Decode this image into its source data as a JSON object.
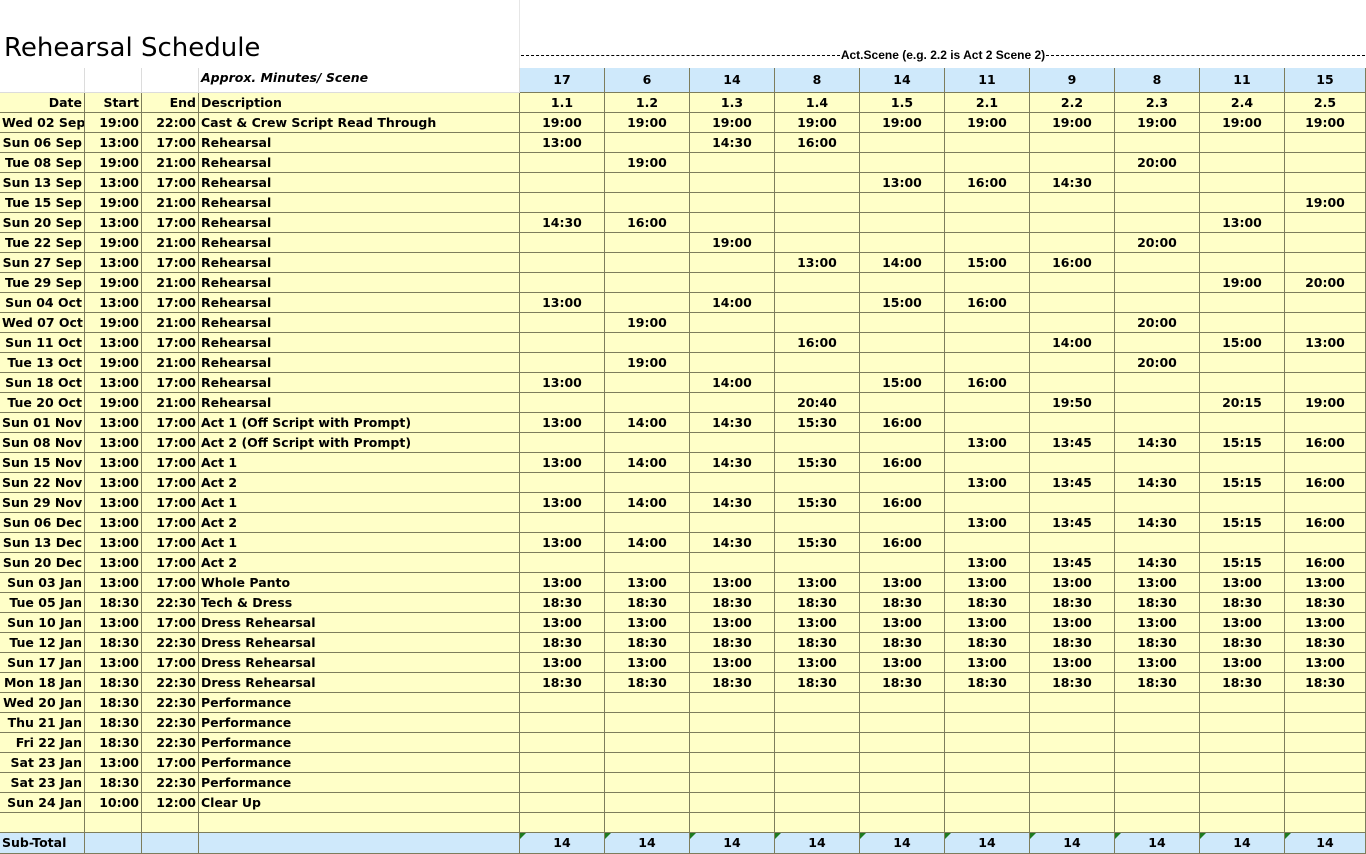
{
  "title": "Rehearsal Schedule",
  "act_scene_label": "Act.Scene (e.g. 2.2 is Act 2 Scene 2)",
  "minutes_label": "Approx. Minutes/ Scene",
  "minutes": [
    "17",
    "6",
    "14",
    "8",
    "14",
    "11",
    "9",
    "8",
    "11",
    "15"
  ],
  "headers": {
    "date": "Date",
    "start": "Start",
    "end": "End",
    "description": "Description"
  },
  "scenes": [
    "1.1",
    "1.2",
    "1.3",
    "1.4",
    "1.5",
    "2.1",
    "2.2",
    "2.3",
    "2.4",
    "2.5"
  ],
  "rows": [
    {
      "date": "Wed 02 Sep",
      "start": "19:00",
      "end": "22:00",
      "desc": "Cast & Crew Script Read Through",
      "s": [
        "19:00",
        "19:00",
        "19:00",
        "19:00",
        "19:00",
        "19:00",
        "19:00",
        "19:00",
        "19:00",
        "19:00"
      ]
    },
    {
      "date": "Sun 06 Sep",
      "start": "13:00",
      "end": "17:00",
      "desc": "Rehearsal",
      "s": [
        "13:00",
        "",
        "14:30",
        "16:00",
        "",
        "",
        "",
        "",
        "",
        ""
      ]
    },
    {
      "date": "Tue 08 Sep",
      "start": "19:00",
      "end": "21:00",
      "desc": "Rehearsal",
      "s": [
        "",
        "19:00",
        "",
        "",
        "",
        "",
        "",
        "20:00",
        "",
        ""
      ]
    },
    {
      "date": "Sun 13 Sep",
      "start": "13:00",
      "end": "17:00",
      "desc": "Rehearsal",
      "s": [
        "",
        "",
        "",
        "",
        "13:00",
        "16:00",
        "14:30",
        "",
        "",
        ""
      ]
    },
    {
      "date": "Tue 15 Sep",
      "start": "19:00",
      "end": "21:00",
      "desc": "Rehearsal",
      "s": [
        "",
        "",
        "",
        "",
        "",
        "",
        "",
        "",
        "",
        "19:00"
      ]
    },
    {
      "date": "Sun 20 Sep",
      "start": "13:00",
      "end": "17:00",
      "desc": "Rehearsal",
      "s": [
        "14:30",
        "16:00",
        "",
        "",
        "",
        "",
        "",
        "",
        "13:00",
        ""
      ]
    },
    {
      "date": "Tue 22 Sep",
      "start": "19:00",
      "end": "21:00",
      "desc": "Rehearsal",
      "s": [
        "",
        "",
        "19:00",
        "",
        "",
        "",
        "",
        "20:00",
        "",
        ""
      ]
    },
    {
      "date": "Sun 27 Sep",
      "start": "13:00",
      "end": "17:00",
      "desc": "Rehearsal",
      "s": [
        "",
        "",
        "",
        "13:00",
        "14:00",
        "15:00",
        "16:00",
        "",
        "",
        ""
      ]
    },
    {
      "date": "Tue 29 Sep",
      "start": "19:00",
      "end": "21:00",
      "desc": "Rehearsal",
      "s": [
        "",
        "",
        "",
        "",
        "",
        "",
        "",
        "",
        "19:00",
        "20:00"
      ]
    },
    {
      "date": "Sun 04 Oct",
      "start": "13:00",
      "end": "17:00",
      "desc": "Rehearsal",
      "s": [
        "13:00",
        "",
        "14:00",
        "",
        "15:00",
        "16:00",
        "",
        "",
        "",
        ""
      ]
    },
    {
      "date": "Wed 07 Oct",
      "start": "19:00",
      "end": "21:00",
      "desc": "Rehearsal",
      "s": [
        "",
        "19:00",
        "",
        "",
        "",
        "",
        "",
        "20:00",
        "",
        ""
      ]
    },
    {
      "date": "Sun 11 Oct",
      "start": "13:00",
      "end": "17:00",
      "desc": "Rehearsal",
      "s": [
        "",
        "",
        "",
        "16:00",
        "",
        "",
        "14:00",
        "",
        "15:00",
        "13:00"
      ]
    },
    {
      "date": "Tue 13 Oct",
      "start": "19:00",
      "end": "21:00",
      "desc": "Rehearsal",
      "s": [
        "",
        "19:00",
        "",
        "",
        "",
        "",
        "",
        "20:00",
        "",
        ""
      ]
    },
    {
      "date": "Sun 18 Oct",
      "start": "13:00",
      "end": "17:00",
      "desc": "Rehearsal",
      "s": [
        "13:00",
        "",
        "14:00",
        "",
        "15:00",
        "16:00",
        "",
        "",
        "",
        ""
      ]
    },
    {
      "date": "Tue 20 Oct",
      "start": "19:00",
      "end": "21:00",
      "desc": "Rehearsal",
      "s": [
        "",
        "",
        "",
        "20:40",
        "",
        "",
        "19:50",
        "",
        "20:15",
        "19:00"
      ]
    },
    {
      "date": "Sun 01 Nov",
      "start": "13:00",
      "end": "17:00",
      "desc": "Act 1 (Off Script with Prompt)",
      "s": [
        "13:00",
        "14:00",
        "14:30",
        "15:30",
        "16:00",
        "",
        "",
        "",
        "",
        ""
      ]
    },
    {
      "date": "Sun 08 Nov",
      "start": "13:00",
      "end": "17:00",
      "desc": "Act 2 (Off Script with Prompt)",
      "s": [
        "",
        "",
        "",
        "",
        "",
        "13:00",
        "13:45",
        "14:30",
        "15:15",
        "16:00"
      ]
    },
    {
      "date": "Sun 15 Nov",
      "start": "13:00",
      "end": "17:00",
      "desc": "Act 1",
      "s": [
        "13:00",
        "14:00",
        "14:30",
        "15:30",
        "16:00",
        "",
        "",
        "",
        "",
        ""
      ]
    },
    {
      "date": "Sun 22 Nov",
      "start": "13:00",
      "end": "17:00",
      "desc": "Act 2",
      "s": [
        "",
        "",
        "",
        "",
        "",
        "13:00",
        "13:45",
        "14:30",
        "15:15",
        "16:00"
      ]
    },
    {
      "date": "Sun 29 Nov",
      "start": "13:00",
      "end": "17:00",
      "desc": "Act 1",
      "s": [
        "13:00",
        "14:00",
        "14:30",
        "15:30",
        "16:00",
        "",
        "",
        "",
        "",
        ""
      ]
    },
    {
      "date": "Sun 06 Dec",
      "start": "13:00",
      "end": "17:00",
      "desc": "Act 2",
      "s": [
        "",
        "",
        "",
        "",
        "",
        "13:00",
        "13:45",
        "14:30",
        "15:15",
        "16:00"
      ]
    },
    {
      "date": "Sun 13 Dec",
      "start": "13:00",
      "end": "17:00",
      "desc": "Act 1",
      "s": [
        "13:00",
        "14:00",
        "14:30",
        "15:30",
        "16:00",
        "",
        "",
        "",
        "",
        ""
      ]
    },
    {
      "date": "Sun 20 Dec",
      "start": "13:00",
      "end": "17:00",
      "desc": "Act 2",
      "s": [
        "",
        "",
        "",
        "",
        "",
        "13:00",
        "13:45",
        "14:30",
        "15:15",
        "16:00"
      ]
    },
    {
      "date": "Sun 03 Jan",
      "start": "13:00",
      "end": "17:00",
      "desc": "Whole Panto",
      "s": [
        "13:00",
        "13:00",
        "13:00",
        "13:00",
        "13:00",
        "13:00",
        "13:00",
        "13:00",
        "13:00",
        "13:00"
      ]
    },
    {
      "date": "Tue 05 Jan",
      "start": "18:30",
      "end": "22:30",
      "desc": "Tech & Dress",
      "s": [
        "18:30",
        "18:30",
        "18:30",
        "18:30",
        "18:30",
        "18:30",
        "18:30",
        "18:30",
        "18:30",
        "18:30"
      ]
    },
    {
      "date": "Sun 10 Jan",
      "start": "13:00",
      "end": "17:00",
      "desc": "Dress Rehearsal",
      "s": [
        "13:00",
        "13:00",
        "13:00",
        "13:00",
        "13:00",
        "13:00",
        "13:00",
        "13:00",
        "13:00",
        "13:00"
      ]
    },
    {
      "date": "Tue 12 Jan",
      "start": "18:30",
      "end": "22:30",
      "desc": "Dress Rehearsal",
      "s": [
        "18:30",
        "18:30",
        "18:30",
        "18:30",
        "18:30",
        "18:30",
        "18:30",
        "18:30",
        "18:30",
        "18:30"
      ]
    },
    {
      "date": "Sun 17 Jan",
      "start": "13:00",
      "end": "17:00",
      "desc": "Dress Rehearsal",
      "s": [
        "13:00",
        "13:00",
        "13:00",
        "13:00",
        "13:00",
        "13:00",
        "13:00",
        "13:00",
        "13:00",
        "13:00"
      ]
    },
    {
      "date": "Mon 18 Jan",
      "start": "18:30",
      "end": "22:30",
      "desc": "Dress Rehearsal",
      "s": [
        "18:30",
        "18:30",
        "18:30",
        "18:30",
        "18:30",
        "18:30",
        "18:30",
        "18:30",
        "18:30",
        "18:30"
      ]
    },
    {
      "date": "Wed 20 Jan",
      "start": "18:30",
      "end": "22:30",
      "desc": "Performance",
      "s": [
        "",
        "",
        "",
        "",
        "",
        "",
        "",
        "",
        "",
        ""
      ]
    },
    {
      "date": "Thu 21 Jan",
      "start": "18:30",
      "end": "22:30",
      "desc": "Performance",
      "s": [
        "",
        "",
        "",
        "",
        "",
        "",
        "",
        "",
        "",
        ""
      ]
    },
    {
      "date": "Fri 22 Jan",
      "start": "18:30",
      "end": "22:30",
      "desc": "Performance",
      "s": [
        "",
        "",
        "",
        "",
        "",
        "",
        "",
        "",
        "",
        ""
      ]
    },
    {
      "date": "Sat 23 Jan",
      "start": "13:00",
      "end": "17:00",
      "desc": "Performance",
      "s": [
        "",
        "",
        "",
        "",
        "",
        "",
        "",
        "",
        "",
        ""
      ]
    },
    {
      "date": "Sat 23 Jan",
      "start": "18:30",
      "end": "22:30",
      "desc": "Performance",
      "s": [
        "",
        "",
        "",
        "",
        "",
        "",
        "",
        "",
        "",
        ""
      ]
    },
    {
      "date": "Sun 24 Jan",
      "start": "10:00",
      "end": "12:00",
      "desc": "Clear Up",
      "s": [
        "",
        "",
        "",
        "",
        "",
        "",
        "",
        "",
        "",
        ""
      ]
    },
    {
      "date": "",
      "start": "",
      "end": "",
      "desc": "",
      "s": [
        "",
        "",
        "",
        "",
        "",
        "",
        "",
        "",
        "",
        ""
      ]
    }
  ],
  "subtotal_label": "Sub-Total",
  "subtotals": [
    "14",
    "14",
    "14",
    "14",
    "14",
    "14",
    "14",
    "14",
    "14",
    "14"
  ],
  "colors": {
    "cell_fill": "#ffffc8",
    "header_fill": "#cfe9fb",
    "grid": "#7d7d5c",
    "error_marker": "#1e7a1e"
  }
}
